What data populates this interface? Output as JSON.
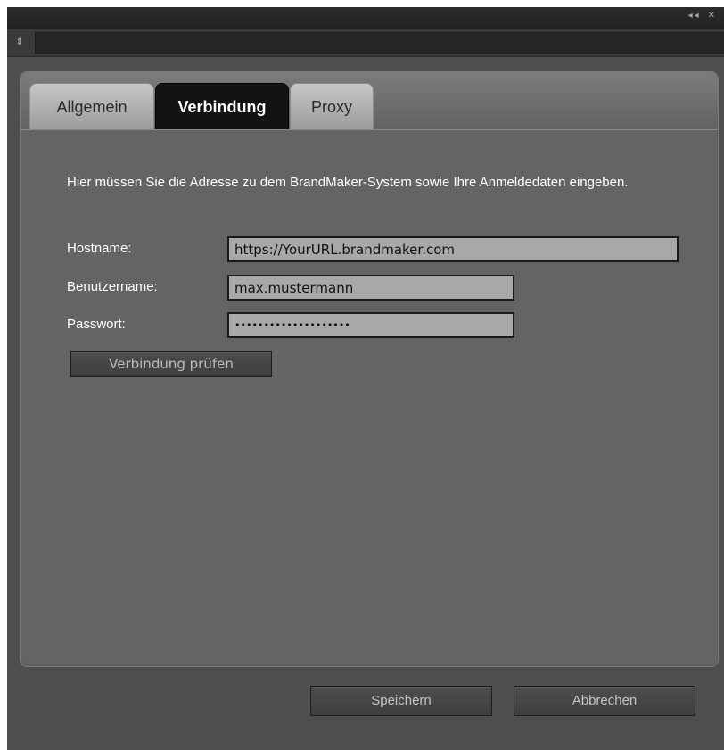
{
  "window": {
    "controls": {
      "collapse": "◂◂",
      "close": "✕"
    },
    "menu_toggle_icon": "⇕"
  },
  "tabs": [
    {
      "label": "Allgemein",
      "active": false
    },
    {
      "label": "Verbindung",
      "active": true
    },
    {
      "label": "Proxy",
      "active": false
    }
  ],
  "connection": {
    "description": "Hier müssen Sie die Adresse zu dem BrandMaker-System sowie Ihre Anmeldedaten eingeben.",
    "hostname": {
      "label": "Hostname:",
      "value": "https://YourURL.brandmaker.com"
    },
    "username": {
      "label": "Benutzername:",
      "value": "max.mustermann"
    },
    "password": {
      "label": "Passwort:",
      "value": "••••••••••••••••••••"
    },
    "check_button": "Verbindung prüfen"
  },
  "footer": {
    "save_button": "Speichern",
    "cancel_button": "Abbrechen"
  },
  "colors": {
    "panel_bg": "#4e4e4e",
    "dialog_bg": "#646464",
    "active_tab": "#131313",
    "input_bg": "#a8a8a8"
  }
}
